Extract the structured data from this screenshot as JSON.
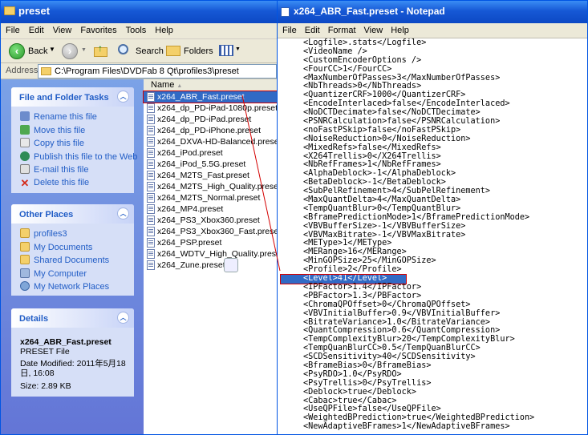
{
  "explorer": {
    "title": "preset",
    "menu": [
      "File",
      "Edit",
      "View",
      "Favorites",
      "Tools",
      "Help"
    ],
    "toolbar": {
      "back": "Back",
      "search": "Search",
      "folders": "Folders"
    },
    "address_label": "Address",
    "address": "C:\\Program Files\\DVDFab 8 Qt\\profiles3\\preset",
    "tasks": {
      "title": "File and Folder Tasks",
      "items": [
        "Rename this file",
        "Move this file",
        "Copy this file",
        "Publish this file to the Web",
        "E-mail this file",
        "Delete this file"
      ]
    },
    "places": {
      "title": "Other Places",
      "items": [
        "profiles3",
        "My Documents",
        "Shared Documents",
        "My Computer",
        "My Network Places"
      ]
    },
    "details": {
      "title": "Details",
      "name": "x264_ABR_Fast.preset",
      "type": "PRESET File",
      "modified": "Date Modified: 2011年5月18日, 16:08",
      "size": "Size: 2.89 KB"
    },
    "column_name": "Name",
    "files": [
      "x264_ABR_Fast.preset",
      "x264_dp_PD-iPad-1080p.preset",
      "x264_dp_PD-iPad.preset",
      "x264_dp_PD-iPhone.preset",
      "x264_DXVA-HD-Balanced.preset",
      "x264_iPod.preset",
      "x264_iPod_5.5G.preset",
      "x264_M2TS_Fast.preset",
      "x264_M2TS_High_Quality.preset",
      "x264_M2TS_Normal.preset",
      "x264_MP4.preset",
      "x264_PS3_Xbox360.preset",
      "x264_PS3_Xbox360_Fast.preset",
      "x264_PSP.preset",
      "x264_WDTV_High_Quality.preset",
      "x264_Zune.preset"
    ]
  },
  "notepad": {
    "title": "x264_ABR_Fast.preset - Notepad",
    "menu": [
      "File",
      "Edit",
      "Format",
      "View",
      "Help"
    ],
    "lines": [
      "<Logfile>.stats</Logfile>",
      "<VideoName />",
      "<CustomEncoderOptions />",
      "<FourCC>1</FourCC>",
      "<MaxNumberOfPasses>3</MaxNumberOfPasses>",
      "<NbThreads>0</NbThreads>",
      "<QuantizerCRF>1000</QuantizerCRF>",
      "<EncodeInterlaced>false</EncodeInterlaced>",
      "<NoDCTDecimate>false</NoDCTDecimate>",
      "<PSNRCalculation>false</PSNRCalculation>",
      "<noFastPSkip>false</noFastPSkip>",
      "<NoiseReduction>0</NoiseReduction>",
      "<MixedRefs>false</MixedRefs>",
      "<X264Trellis>0</X264Trellis>",
      "<NbRefFrames>1</NbRefFrames>",
      "<AlphaDeblock>-1</AlphaDeblock>",
      "<BetaDeblock>-1</BetaDeblock>",
      "<SubPelRefinement>4</SubPelRefinement>",
      "<MaxQuantDelta>4</MaxQuantDelta>",
      "<TempQuantBlur>0</TempQuantBlur>",
      "<BframePredictionMode>1</BframePredictionMode>",
      "<VBVBufferSize>-1</VBVBufferSize>",
      "<VBVMaxBitrate>-1</VBVMaxBitrate>",
      "<METype>1</METype>",
      "<MERange>16</MERange>",
      "<MinGOPSize>25</MinGOPSize>",
      "<Profile>2</Profile>",
      "<Level>41</Level>",
      "<IPFactor>1.4</IPFactor>",
      "<PBFactor>1.3</PBFactor>",
      "<ChromaQPOffset>0</ChromaQPOffset>",
      "<VBVInitialBuffer>0.9</VBVInitialBuffer>",
      "<BitrateVariance>1.0</BitrateVariance>",
      "<QuantCompression>0.6</QuantCompression>",
      "<TempComplexityBlur>20</TempComplexityBlur>",
      "<TempQuanBlurCC>0.5</TempQuanBlurCC>",
      "<SCDSensitivity>40</SCDSensitivity>",
      "<BframeBias>0</BframeBias>",
      "<PsyRDO>1.0</PsyRDO>",
      "<PsyTrellis>0</PsyTrellis>",
      "<Deblock>true</Deblock>",
      "<Cabac>true</Cabac>",
      "<UseQPFile>false</UseQPFile>",
      "<WeightedBPrediction>true</WeightedBPrediction>",
      "<NewAdaptiveBFrames>1</NewAdaptiveBFrames>"
    ],
    "highlighted_line": 27
  }
}
